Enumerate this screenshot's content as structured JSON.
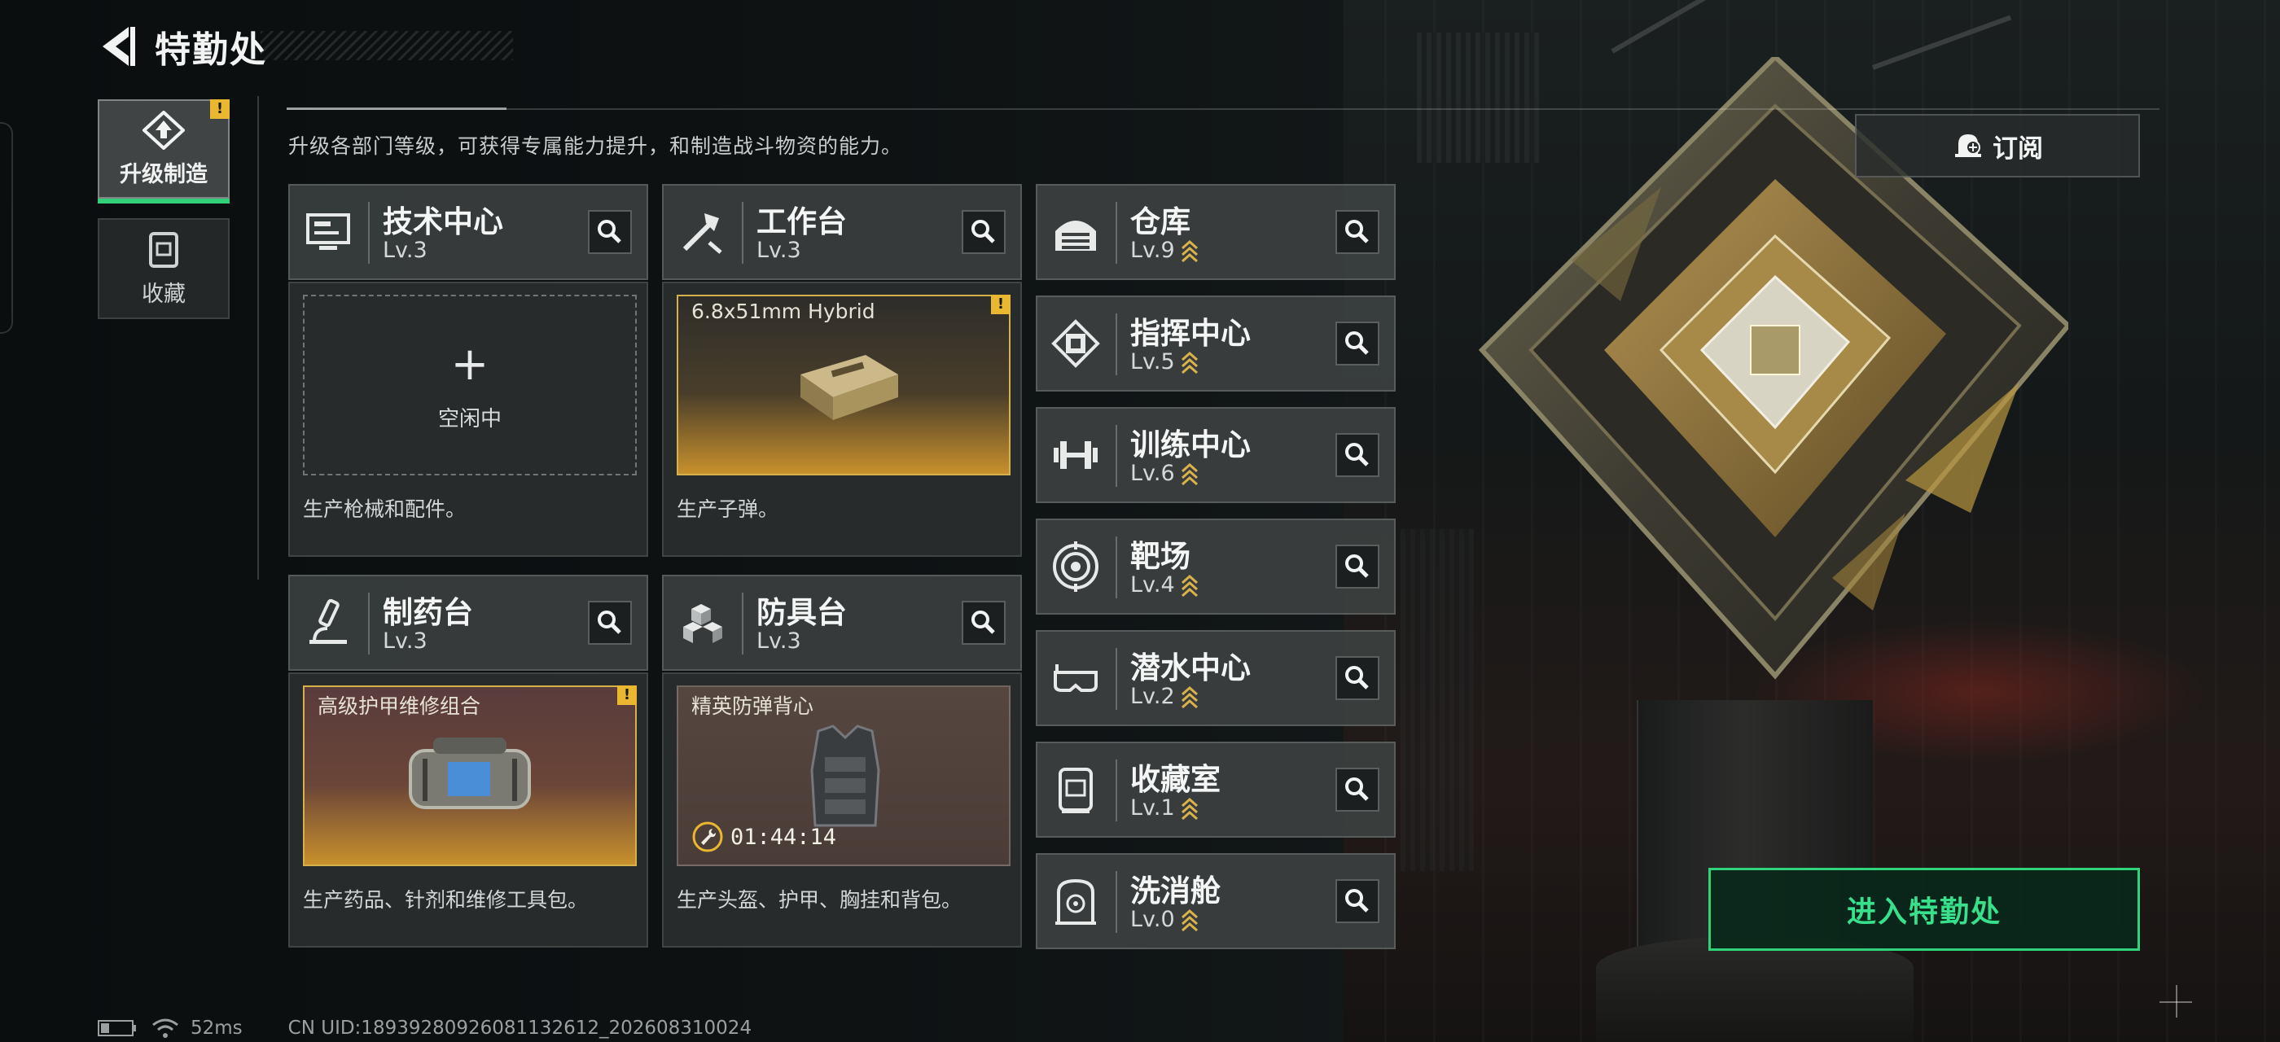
{
  "header": {
    "title": "特勤处"
  },
  "description": "升级各部门等级，可获得专属能力提升，和制造战斗物资的能力。",
  "side_tabs": [
    {
      "label": "升级制造",
      "icon": "upgrade-build-icon",
      "active": true,
      "alert": "!"
    },
    {
      "label": "收藏",
      "icon": "collection-icon",
      "active": false
    }
  ],
  "workshop_cards": [
    {
      "name": "技术中心",
      "level": "Lv.3",
      "icon": "tech-center-icon",
      "slot_state": "idle",
      "slot_plus": "+",
      "slot_text": "空闲中",
      "footer": "生产枪械和配件。"
    },
    {
      "name": "工作台",
      "level": "Lv.3",
      "icon": "workbench-icon",
      "slot_state": "ready",
      "item_name": "6.8x51mm Hybrid",
      "alert": "!",
      "footer": "生产子弹。"
    },
    {
      "name": "制药台",
      "level": "Lv.3",
      "icon": "pharmacy-icon",
      "slot_state": "ready",
      "item_name": "高级护甲维修组合",
      "alert": "!",
      "footer": "生产药品、针剂和维修工具包。"
    },
    {
      "name": "防具台",
      "level": "Lv.3",
      "icon": "armor-bench-icon",
      "slot_state": "crafting",
      "item_name": "精英防弹背心",
      "timer": "01:44:14",
      "footer": "生产头盔、护甲、胸挂和背包。"
    }
  ],
  "department_list": [
    {
      "name": "仓库",
      "level": "Lv.9",
      "icon": "warehouse-icon"
    },
    {
      "name": "指挥中心",
      "level": "Lv.5",
      "icon": "command-center-icon"
    },
    {
      "name": "训练中心",
      "level": "Lv.6",
      "icon": "training-center-icon"
    },
    {
      "name": "靶场",
      "level": "Lv.4",
      "icon": "shooting-range-icon"
    },
    {
      "name": "潜水中心",
      "level": "Lv.2",
      "icon": "diving-center-icon"
    },
    {
      "name": "收藏室",
      "level": "Lv.1",
      "icon": "collection-room-icon"
    },
    {
      "name": "洗消舱",
      "level": "Lv.0",
      "icon": "decon-chamber-icon"
    }
  ],
  "subscribe": {
    "label": "订阅"
  },
  "enter_button": {
    "label": "进入特勤处"
  },
  "status_bar": {
    "ping": "52ms",
    "uid": "CN UID:18939280926081132612_202608310024"
  },
  "colors": {
    "accent_green": "#2ed37a",
    "alert_yellow": "#e9b830",
    "item_gold": "#d6b14a"
  }
}
